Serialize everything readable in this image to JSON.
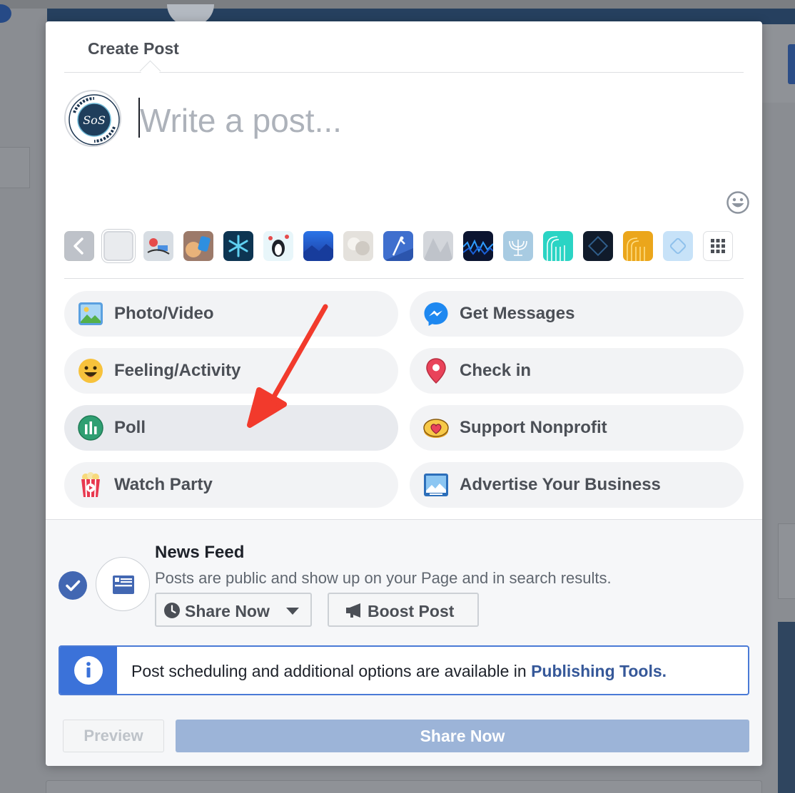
{
  "dialog": {
    "tab_label": "Create Post",
    "composer": {
      "placeholder": "Write a post..."
    }
  },
  "backgrounds": [
    {
      "name": "none",
      "color": "#e9ebee"
    },
    {
      "name": "comic-stickers",
      "color": "#d7dde3"
    },
    {
      "name": "drinks",
      "color": "#c9a98c"
    },
    {
      "name": "snowflake",
      "color": "#0f3d5e"
    },
    {
      "name": "penguins",
      "color": "#e6f5f9"
    },
    {
      "name": "blue-mountains",
      "color": "#1e56c9"
    },
    {
      "name": "cotton",
      "color": "#d6d2cc"
    },
    {
      "name": "figure-skater",
      "color": "#3b6fd0"
    },
    {
      "name": "frost",
      "color": "#c9ccd2"
    },
    {
      "name": "waves-dark",
      "color": "#0e1a33"
    },
    {
      "name": "menorah",
      "color": "#a3c7e0"
    },
    {
      "name": "teal-candles",
      "color": "#25d1c2"
    },
    {
      "name": "dark-dreidel",
      "color": "#0f1c2d"
    },
    {
      "name": "gold-candles",
      "color": "#eba61b"
    },
    {
      "name": "light-dreidel",
      "color": "#c9e4fa"
    }
  ],
  "options": {
    "left": [
      {
        "label": "Photo/Video",
        "icon": "photo-video-icon"
      },
      {
        "label": "Feeling/Activity",
        "icon": "feeling-icon"
      },
      {
        "label": "Poll",
        "icon": "poll-icon"
      },
      {
        "label": "Watch Party",
        "icon": "watch-party-icon"
      }
    ],
    "right": [
      {
        "label": "Get Messages",
        "icon": "messenger-icon"
      },
      {
        "label": "Check in",
        "icon": "location-pin-icon"
      },
      {
        "label": "Support Nonprofit",
        "icon": "nonprofit-heart-icon"
      },
      {
        "label": "Advertise Your Business",
        "icon": "advertise-icon"
      }
    ]
  },
  "audience": {
    "title": "News Feed",
    "description": "Posts are public and show up on your Page and in search results.",
    "share_now_label": "Share Now",
    "boost_label": "Boost Post"
  },
  "info": {
    "text": "Post scheduling and additional options are available in ",
    "link": "Publishing Tools."
  },
  "footer": {
    "preview_label": "Preview",
    "share_label": "Share Now"
  },
  "colors": {
    "accent": "#4267b2",
    "link": "#365899",
    "annotation_arrow": "#f23a2c"
  }
}
